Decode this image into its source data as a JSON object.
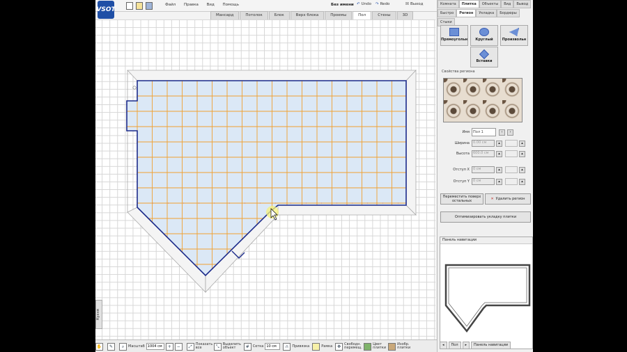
{
  "logo": {
    "text": "VSOT"
  },
  "menu": {
    "items": [
      "Файл",
      "Правка",
      "Вид",
      "Помощь"
    ]
  },
  "project": {
    "name": "Без имени"
  },
  "toolbar": {
    "undo": "Undo",
    "redo": "Redo",
    "exit": "Выход"
  },
  "view_tabs": [
    "Мансард",
    "Потолок",
    "Блок",
    "Верх блока",
    "Проемы",
    "Пол",
    "Стены",
    "3D"
  ],
  "view_tabs_active": "Пол",
  "right_tabs_row1": [
    "Комната",
    "Плитка",
    "Объекты",
    "Вид",
    "Вывод"
  ],
  "right_tabs_row2": [
    "Быстро",
    "Регион",
    "Укладка",
    "Бордюры",
    "Стыки"
  ],
  "right_tabs_active": [
    "Плитка",
    "Регион"
  ],
  "shapes": {
    "rect": "Прямоугольн",
    "round": "Круглый",
    "free": "Произвольн",
    "inserts": "Вставки"
  },
  "region_props": {
    "title": "Свойства региона",
    "name_label": "Имя",
    "name_value": "Пол 1",
    "width_label": "Ширина",
    "width_value": "0.00 см",
    "height_label": "Высота",
    "height_value": "600.0 см",
    "offset_x_label": "Отступ X",
    "offset_x_value": "0 см",
    "offset_y_label": "Отступ Y",
    "offset_y_value": "0 см"
  },
  "actions": {
    "move_over": "Переместить поверх остальных",
    "delete_region": "Удалить регион",
    "optimize": "Оптимизировать укладку плитки"
  },
  "nav_panel": {
    "title": "Панель навигации",
    "floor_tab": "Пол",
    "nav_tab": "Панель навигации"
  },
  "bottom": {
    "scale_label": "Масштаб",
    "scale_value": "1004 см",
    "show_all": "Показать все",
    "select_objects": "Выделить объект",
    "grid_label": "Сетка",
    "grid_value": "10 см",
    "snap": "Привязка",
    "frame": "Рамка",
    "free_move": "Свободн. перемещ.",
    "tile_color": "Цвет плитки",
    "tile_image": "Изобр. плитки"
  },
  "side_tab": "Кухня",
  "colors": {
    "wall": "#1b2a8a",
    "tile_line": "#f0a030",
    "floor_fill": "#dbe8f6",
    "active_tab": "#ffffff"
  }
}
